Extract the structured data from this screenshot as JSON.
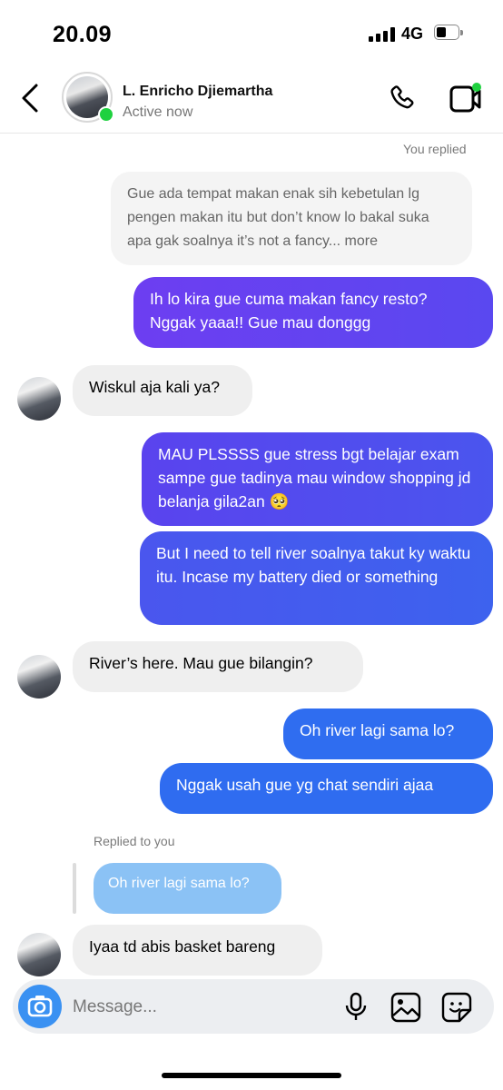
{
  "status_bar": {
    "time": "20.09",
    "network": "4G"
  },
  "header": {
    "name": "L. Enricho Djiemartha",
    "status": "Active now"
  },
  "meta": {
    "you_replied": "You replied",
    "replied_to_you": "Replied to you"
  },
  "messages": [
    {
      "side": "quote",
      "text": "Gue ada tempat makan enak sih kebetulan lg pengen makan itu but don’t know lo bakal suka apa gak soalnya it’s not a fancy... more"
    },
    {
      "side": "out",
      "text": "Ih lo kira gue cuma makan fancy resto? Nggak yaaa!! Gue mau donggg"
    },
    {
      "side": "in",
      "text": "Wiskul aja kali ya?"
    },
    {
      "side": "out",
      "text": "MAU PLSSSS gue stress bgt belajar exam sampe gue tadinya mau window shopping jd belanja gila2an 🥺"
    },
    {
      "side": "out",
      "text": "But I need to tell river soalnya takut ky waktu itu. Incase my battery died or something"
    },
    {
      "side": "in",
      "text": "River’s here. Mau gue bilangin?"
    },
    {
      "side": "out",
      "text": "Oh river lagi sama lo?"
    },
    {
      "side": "out",
      "text": "Nggak usah gue yg chat sendiri ajaa"
    },
    {
      "side": "reply-quote",
      "text": "Oh river lagi sama lo?"
    },
    {
      "side": "in",
      "text": "Iyaa td abis basket bareng"
    }
  ],
  "composer": {
    "placeholder": "Message..."
  },
  "colors": {
    "accent_blue": "#3a91f2",
    "bubble_purple": "#6a3df0",
    "bubble_blue": "#2f6ef0",
    "online_green": "#1fd13f"
  },
  "icons": [
    "back-arrow-icon",
    "phone-icon",
    "video-call-icon",
    "camera-icon",
    "microphone-icon",
    "gallery-icon",
    "sticker-icon"
  ]
}
